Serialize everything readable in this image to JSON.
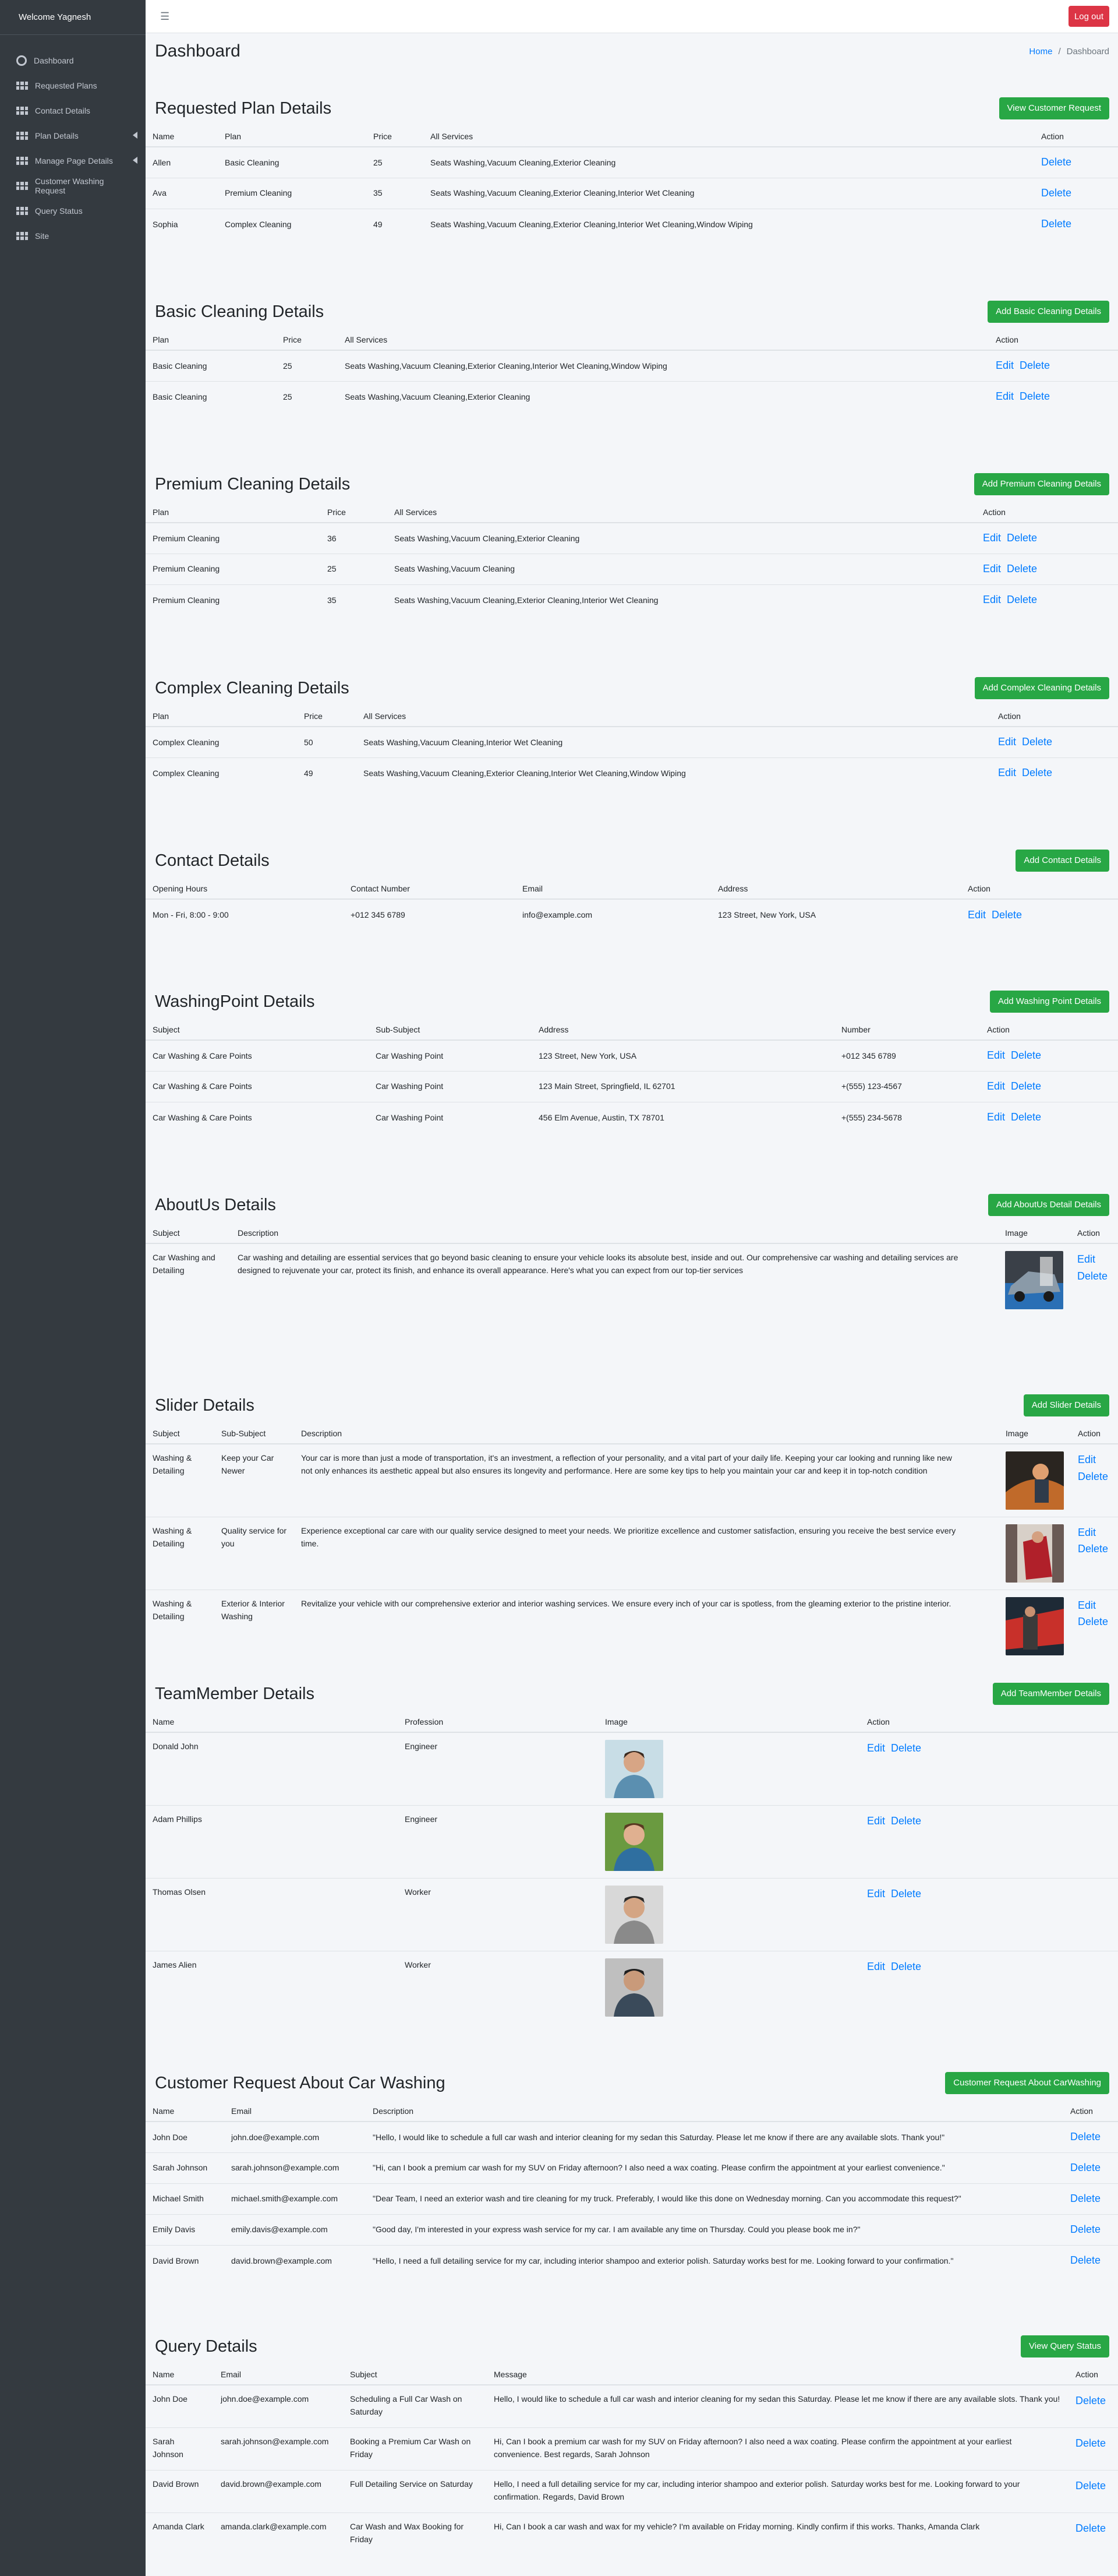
{
  "sidebar": {
    "welcome": "Welcome Yagnesh",
    "items": [
      {
        "label": "Dashboard"
      },
      {
        "label": "Requested Plans"
      },
      {
        "label": "Contact Details"
      },
      {
        "label": "Plan Details"
      },
      {
        "label": "Manage Page Details"
      },
      {
        "label": "Customer Washing Request"
      },
      {
        "label": "Query Status"
      },
      {
        "label": "Site"
      }
    ]
  },
  "topbar": {
    "menu_icon": "☰",
    "logout": "Log out"
  },
  "header": {
    "title": "Dashboard",
    "crumb_home": "Home",
    "crumb_sep": "/",
    "crumb_current": "Dashboard"
  },
  "actions": {
    "edit": "Edit",
    "delete": "Delete"
  },
  "requested": {
    "title": "Requested Plan Details",
    "button": "View Customer Request",
    "columns": [
      "Name",
      "Plan",
      "Price",
      "All Services",
      "Action"
    ],
    "rows": [
      [
        "Allen",
        "Basic Cleaning",
        "25",
        "Seats Washing,Vacuum Cleaning,Exterior Cleaning"
      ],
      [
        "Ava",
        "Premium Cleaning",
        "35",
        "Seats Washing,Vacuum Cleaning,Exterior Cleaning,Interior Wet Cleaning"
      ],
      [
        "Sophia",
        "Complex Cleaning",
        "49",
        "Seats Washing,Vacuum Cleaning,Exterior Cleaning,Interior Wet Cleaning,Window Wiping"
      ]
    ]
  },
  "basic": {
    "title": "Basic Cleaning Details",
    "button": "Add Basic Cleaning Details",
    "columns": [
      "Plan",
      "Price",
      "All Services",
      "Action"
    ],
    "rows": [
      [
        "Basic Cleaning",
        "25",
        "Seats Washing,Vacuum Cleaning,Exterior Cleaning,Interior Wet Cleaning,Window Wiping"
      ],
      [
        "Basic Cleaning",
        "25",
        "Seats Washing,Vacuum Cleaning,Exterior Cleaning"
      ]
    ]
  },
  "premium": {
    "title": "Premium Cleaning Details",
    "button": "Add Premium Cleaning Details",
    "columns": [
      "Plan",
      "Price",
      "All Services",
      "Action"
    ],
    "rows": [
      [
        "Premium Cleaning",
        "36",
        "Seats Washing,Vacuum Cleaning,Exterior Cleaning"
      ],
      [
        "Premium Cleaning",
        "25",
        "Seats Washing,Vacuum Cleaning"
      ],
      [
        "Premium Cleaning",
        "35",
        "Seats Washing,Vacuum Cleaning,Exterior Cleaning,Interior Wet Cleaning"
      ]
    ]
  },
  "complex": {
    "title": "Complex Cleaning Details",
    "button": "Add Complex Cleaning Details",
    "columns": [
      "Plan",
      "Price",
      "All Services",
      "Action"
    ],
    "rows": [
      [
        "Complex Cleaning",
        "50",
        "Seats Washing,Vacuum Cleaning,Interior Wet Cleaning"
      ],
      [
        "Complex Cleaning",
        "49",
        "Seats Washing,Vacuum Cleaning,Exterior Cleaning,Interior Wet Cleaning,Window Wiping"
      ]
    ]
  },
  "contact": {
    "title": "Contact Details",
    "button": "Add Contact Details",
    "columns": [
      "Opening Hours",
      "Contact Number",
      "Email",
      "Address",
      "Action"
    ],
    "rows": [
      [
        "Mon - Fri, 8:00 - 9:00",
        "+012 345 6789",
        "info@example.com",
        "123 Street, New York, USA"
      ]
    ]
  },
  "washing": {
    "title": "WashingPoint Details",
    "button": "Add Washing Point Details",
    "columns": [
      "Subject",
      "Sub-Subject",
      "Address",
      "Number",
      "Action"
    ],
    "rows": [
      [
        "Car Washing & Care Points",
        "Car Washing Point",
        "123 Street, New York, USA",
        "+012 345 6789"
      ],
      [
        "Car Washing & Care Points",
        "Car Washing Point",
        "123 Main Street, Springfield, IL 62701",
        "+(555) 123-4567"
      ],
      [
        "Car Washing & Care Points",
        "Car Washing Point",
        "456 Elm Avenue, Austin, TX 78701",
        "+(555) 234-5678"
      ]
    ]
  },
  "about": {
    "title": "AboutUs Details",
    "button": "Add AboutUs Detail Details",
    "columns": [
      "Subject",
      "Description",
      "Image",
      "Action"
    ],
    "rows": [
      [
        "Car Washing and Detailing",
        "Car washing and detailing are essential services that go beyond basic cleaning to ensure your vehicle looks its absolute best, inside and out. Our comprehensive car washing and detailing services are designed to rejuvenate your car, protect its finish, and enhance its overall appearance. Here's what you can expect from our top-tier services"
      ]
    ]
  },
  "slider": {
    "title": "Slider Details",
    "button": "Add Slider Details",
    "columns": [
      "Subject",
      "Sub-Subject",
      "Description",
      "Image",
      "Action"
    ],
    "rows": [
      [
        "Washing & Detailing",
        "Keep your Car Newer",
        "Your car is more than just a mode of transportation, it's an investment, a reflection of your personality, and a vital part of your daily life. Keeping your car looking and running like new not only enhances its aesthetic appeal but also ensures its longevity and performance. Here are some key tips to help you maintain your car and keep it in top-notch condition"
      ],
      [
        "Washing & Detailing",
        "Quality service for you",
        "Experience exceptional car care with our quality service designed to meet your needs. We prioritize excellence and customer satisfaction, ensuring you receive the best service every time."
      ],
      [
        "Washing & Detailing",
        "Exterior & Interior Washing",
        "Revitalize your vehicle with our comprehensive exterior and interior washing services. We ensure every inch of your car is spotless, from the gleaming exterior to the pristine interior."
      ]
    ]
  },
  "team": {
    "title": "TeamMember Details",
    "button": "Add TeamMember Details",
    "columns": [
      "Name",
      "Profession",
      "Image",
      "Action"
    ],
    "rows": [
      [
        "Donald John",
        "Engineer"
      ],
      [
        "Adam Phillips",
        "Engineer"
      ],
      [
        "Thomas Olsen",
        "Worker"
      ],
      [
        "James Alien",
        "Worker"
      ]
    ]
  },
  "custreq": {
    "title": "Customer Request About Car Washing",
    "button": "Customer Request About CarWashing",
    "columns": [
      "Name",
      "Email",
      "Description",
      "Action"
    ],
    "rows": [
      [
        "John Doe",
        "john.doe@example.com",
        "\"Hello, I would like to schedule a full car wash and interior cleaning for my sedan this Saturday. Please let me know if there are any available slots. Thank you!\""
      ],
      [
        "Sarah Johnson",
        "sarah.johnson@example.com",
        "\"Hi, can I book a premium car wash for my SUV on Friday afternoon? I also need a wax coating. Please confirm the appointment at your earliest convenience.\""
      ],
      [
        "Michael Smith",
        "michael.smith@example.com",
        "\"Dear Team, I need an exterior wash and tire cleaning for my truck. Preferably, I would like this done on Wednesday morning. Can you accommodate this request?\""
      ],
      [
        "Emily Davis",
        "emily.davis@example.com",
        "\"Good day, I'm interested in your express wash service for my car. I am available any time on Thursday. Could you please book me in?\""
      ],
      [
        "David Brown",
        "david.brown@example.com",
        "\"Hello, I need a full detailing service for my car, including interior shampoo and exterior polish. Saturday works best for me. Looking forward to your confirmation.\""
      ]
    ]
  },
  "query": {
    "title": "Query Details",
    "button": "View Query Status",
    "columns": [
      "Name",
      "Email",
      "Subject",
      "Message",
      "Action"
    ],
    "rows": [
      [
        "John Doe",
        "john.doe@example.com",
        "Scheduling a Full Car Wash on Saturday",
        "Hello, I would like to schedule a full car wash and interior cleaning for my sedan this Saturday. Please let me know if there are any available slots. Thank you!"
      ],
      [
        "Sarah Johnson",
        "sarah.johnson@example.com",
        "Booking a Premium Car Wash on Friday",
        "Hi, Can I book a premium car wash for my SUV on Friday afternoon? I also need a wax coating. Please confirm the appointment at your earliest convenience. Best regards, Sarah Johnson"
      ],
      [
        "David Brown",
        "david.brown@example.com",
        "Full Detailing Service on Saturday",
        "Hello, I need a full detailing service for my car, including interior shampoo and exterior polish. Saturday works best for me. Looking forward to your confirmation. Regards, David Brown"
      ],
      [
        "Amanda Clark",
        "amanda.clark@example.com",
        "Car Wash and Wax Booking for Friday",
        "Hi, Can I book a car wash and wax for my vehicle? I'm available on Friday morning. Kindly confirm if this works. Thanks, Amanda Clark"
      ]
    ]
  }
}
